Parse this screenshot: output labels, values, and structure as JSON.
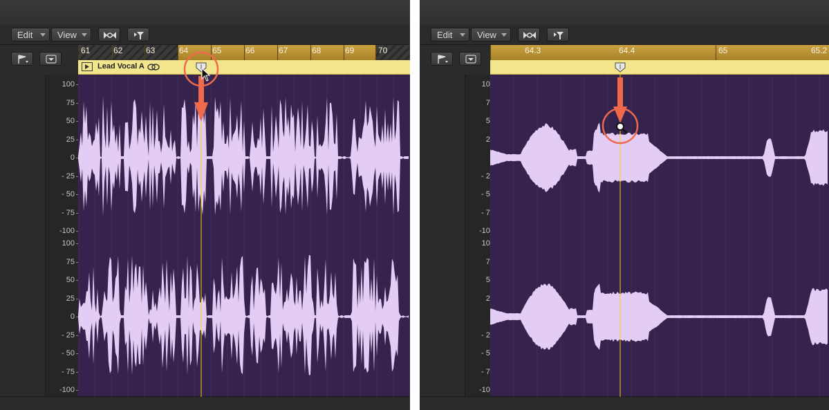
{
  "toolbar": {
    "edit_label": "Edit",
    "view_label": "View"
  },
  "left_panel": {
    "ruler_labels": [
      "61",
      "62",
      "63",
      "64",
      "65",
      "66",
      "67",
      "68",
      "69",
      "70"
    ],
    "region_name": "Lead Vocal A"
  },
  "right_panel": {
    "ruler_labels": [
      "64.3",
      "64.4",
      "65",
      "65.2"
    ]
  },
  "amplitude_scale": {
    "upper": [
      "100",
      "75",
      "50",
      "25",
      "0",
      "- 25",
      "- 50",
      "- 75",
      "-100"
    ],
    "lower": [
      "100",
      "75",
      "50",
      "25",
      "0",
      "- 25",
      "- 50",
      "- 75",
      "-100"
    ]
  },
  "colors": {
    "waveform_bg": "#35234d",
    "waveform_fill": "#e3cdf5",
    "ruler": "#b8902f",
    "region_bar": "#f2e58c",
    "playhead": "#f1d21c",
    "highlight": "#ef6a4b"
  },
  "icons": [
    "flex-icon",
    "catch-icon",
    "flag-icon",
    "dropdown-icon",
    "region-play-icon",
    "loop-icon",
    "marker-icon",
    "cursor-icon",
    "magnifier-icon",
    "arrow-down-icon"
  ]
}
